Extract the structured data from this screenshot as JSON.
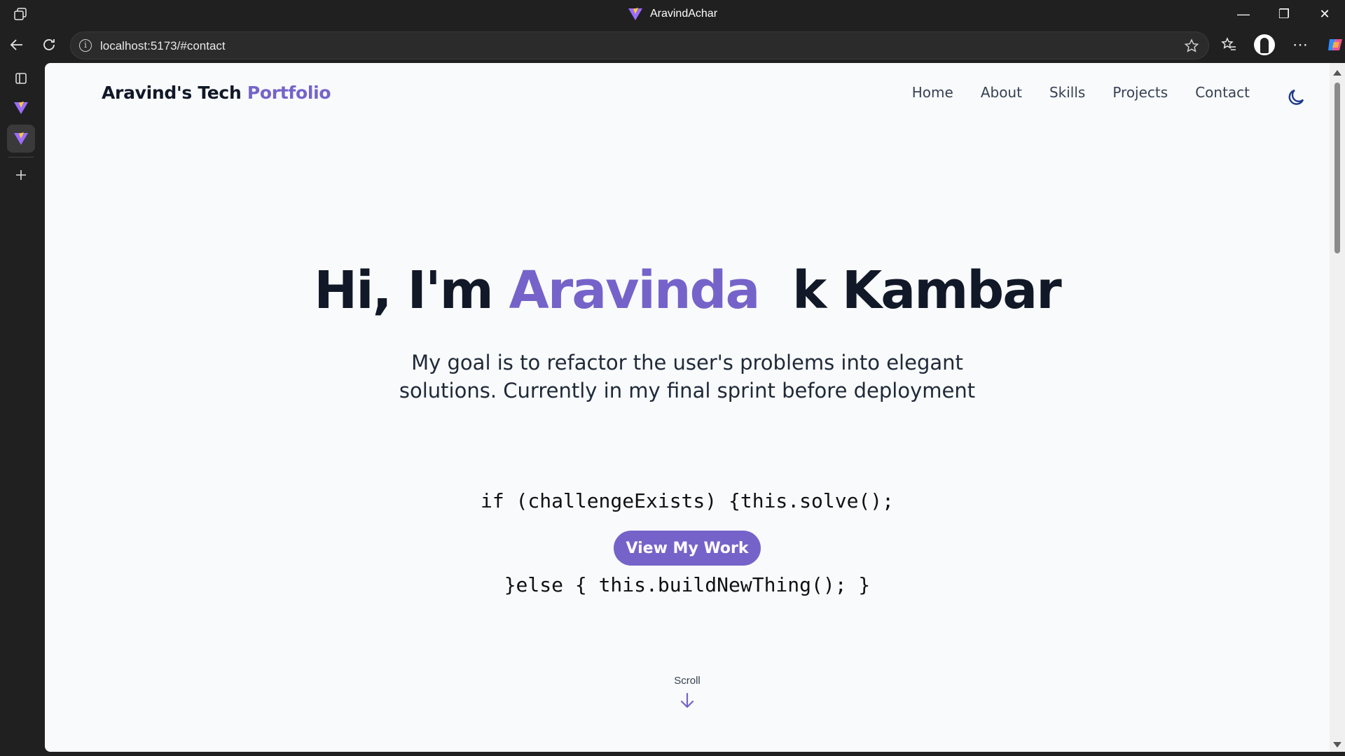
{
  "browser": {
    "window_title": "AravindAchar",
    "url": "localhost:5173/#contact"
  },
  "site": {
    "brand_prefix": "Aravind's Tech ",
    "brand_accent": "Portfolio",
    "nav": [
      "Home",
      "About",
      "Skills",
      "Projects",
      "Contact"
    ],
    "hero": {
      "greeting": "Hi, I'm ",
      "name_accent": "Aravinda",
      "name_rest": "k Kambar",
      "subtitle_line1": "My goal is to refactor the user's problems into elegant",
      "subtitle_line2": "solutions. Currently in my final sprint before deployment",
      "code_line1": "if (challengeExists) {this.solve();",
      "code_line2": "}else { this.buildNewThing(); }",
      "cta_label": "View My Work",
      "scroll_label": "Scroll"
    }
  },
  "colors": {
    "accent": "#7663c9",
    "page_bg": "#f8fafc",
    "text_dark": "#111827",
    "chrome_bg": "#202020"
  },
  "icons": {
    "theme_toggle": "moon-icon",
    "scroll": "arrow-down-icon"
  }
}
